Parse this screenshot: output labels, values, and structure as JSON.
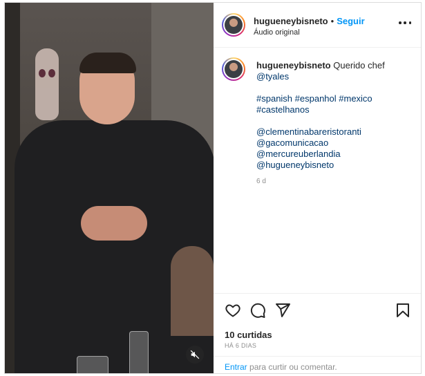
{
  "post": {
    "username": "hugueneybisneto",
    "separator": "•",
    "follow_label": "Seguir",
    "audio_label": "Áudio original"
  },
  "caption": {
    "username": "hugueneybisneto",
    "text": "Querido chef",
    "mention_chef": "@tyales",
    "hashtags_line1": "#spanish #espanhol #mexico",
    "hashtags_line2": "#castelhanos",
    "mentions": [
      "@clementinabareristoranti",
      "@gacomunicacao",
      "@mercureuberlandia",
      "@hugueneybisneto"
    ],
    "age": "6 d"
  },
  "actions": {
    "likes": "10 curtidas",
    "time_ago": "HÁ 6 DIAS",
    "login_link": "Entrar",
    "login_rest": " para curtir ou comentar."
  },
  "icons": {
    "more": "more-options-icon",
    "like": "heart-icon",
    "comment": "comment-icon",
    "share": "share-icon",
    "save": "bookmark-icon",
    "mute": "muted-speaker-icon"
  },
  "colors": {
    "link_blue": "#0095f6",
    "tag_blue": "#00376b",
    "muted_grey": "#8e8e8e"
  }
}
